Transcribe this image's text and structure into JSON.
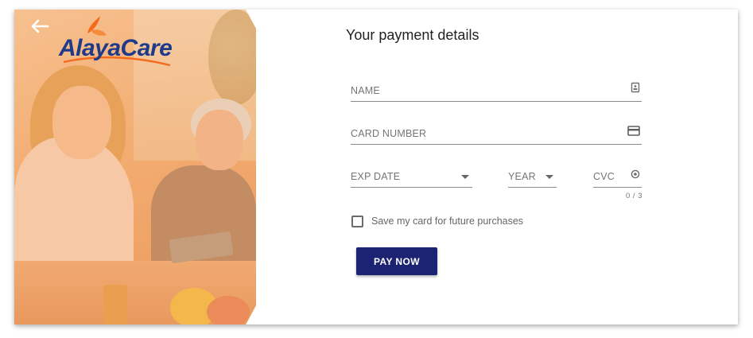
{
  "brand": {
    "logo_text": "AlayaCare",
    "logo_color": "#1e3a8a",
    "leaf_color": "#f26b1d"
  },
  "nav": {
    "back_icon": "arrow-left-icon"
  },
  "form": {
    "title": "Your payment details",
    "fields": {
      "name": {
        "placeholder": "NAME",
        "icon": "contact-card-icon"
      },
      "card_number": {
        "placeholder": "CARD NUMBER",
        "icon": "credit-card-icon"
      },
      "exp_date": {
        "placeholder": "EXP DATE",
        "icon": "chevron-down-icon"
      },
      "year": {
        "placeholder": "YEAR",
        "icon": "chevron-down-icon"
      },
      "cvc": {
        "placeholder": "CVC",
        "icon": "cvc-help-icon",
        "counter": "0 / 3"
      }
    },
    "save_card": {
      "label": "Save my card for future purchases",
      "checked": false
    },
    "submit": {
      "label": "PAY NOW",
      "color": "#1c2372"
    }
  },
  "image": {
    "subject": "caregiver-with-elderly-woman-photo",
    "tint": "#f2a76a"
  }
}
